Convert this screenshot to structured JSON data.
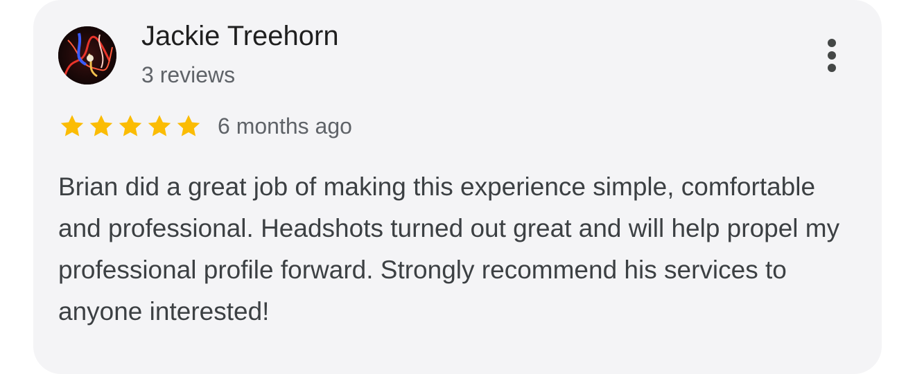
{
  "review": {
    "author_name": "Jackie Treehorn",
    "author_reviews": "3 reviews",
    "rating": 5,
    "rating_max": 5,
    "time_ago": "6 months ago",
    "text": "Brian did a great job of making this experience simple, comfortable and professional. Headshots turned out great and will help propel my professional profile forward. Strongly recommend his services to anyone interested!"
  },
  "icons": {
    "avatar": "avatar-photo",
    "menu": "more-vert-icon",
    "star": "star-icon"
  },
  "colors": {
    "card_background": "#f4f4f6",
    "star": "#fbbc04",
    "name": "#1f1f1f",
    "secondary_text": "#5f6368",
    "body_text": "#3c4043"
  }
}
